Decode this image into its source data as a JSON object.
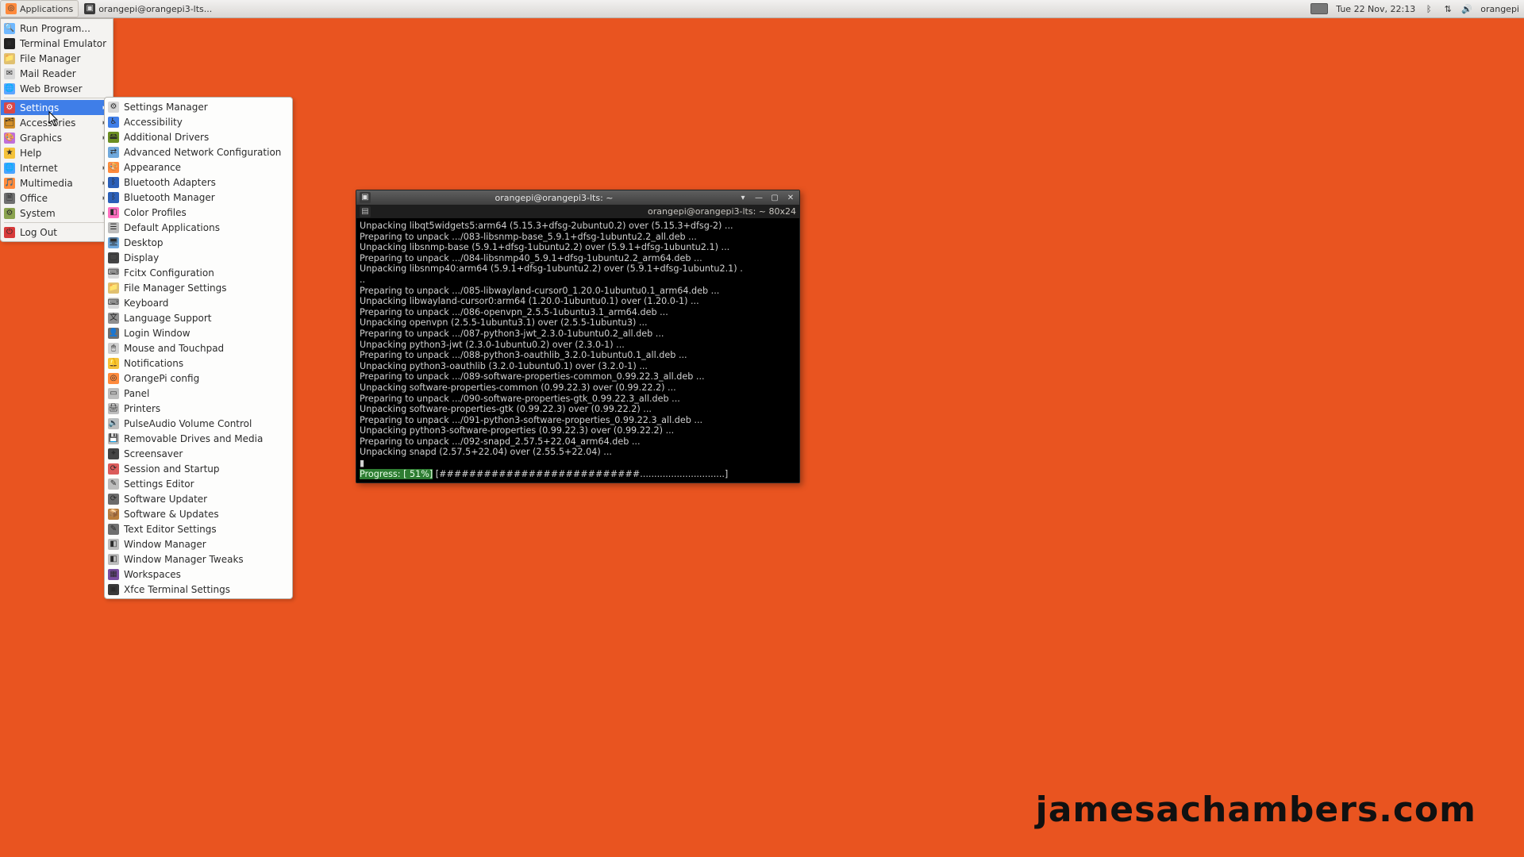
{
  "panel": {
    "applications_label": "Applications",
    "task_label": "orangepi@orangepi3-lts...",
    "clock": "Tue 22 Nov, 22:13",
    "user": "orangepi"
  },
  "menu": {
    "items": [
      {
        "label": "Run Program...",
        "icon_bg": "#6fb8ff",
        "glyph": "🔍",
        "arrow": false
      },
      {
        "label": "Terminal Emulator",
        "icon_bg": "#222",
        "glyph": "▣",
        "arrow": false
      },
      {
        "label": "File Manager",
        "icon_bg": "#e0c070",
        "glyph": "📁",
        "arrow": false
      },
      {
        "label": "Mail Reader",
        "icon_bg": "#d8d8d8",
        "glyph": "✉",
        "arrow": false
      },
      {
        "label": "Web Browser",
        "icon_bg": "#5da5ff",
        "glyph": "🌐",
        "arrow": false
      },
      {
        "label": "Settings",
        "icon_bg": "#d94747",
        "glyph": "⚙",
        "arrow": true,
        "highlight": true
      },
      {
        "label": "Accessories",
        "icon_bg": "#d28f2a",
        "glyph": "🗂",
        "arrow": true
      },
      {
        "label": "Graphics",
        "icon_bg": "#c06fd8",
        "glyph": "🎨",
        "arrow": true
      },
      {
        "label": "Help",
        "icon_bg": "#f4c23a",
        "glyph": "★",
        "arrow": false
      },
      {
        "label": "Internet",
        "icon_bg": "#4aa3ff",
        "glyph": "🌐",
        "arrow": true
      },
      {
        "label": "Multimedia",
        "icon_bg": "#ff8a3c",
        "glyph": "🎵",
        "arrow": true
      },
      {
        "label": "Office",
        "icon_bg": "#6f6f6f",
        "glyph": "🗎",
        "arrow": true
      },
      {
        "label": "System",
        "icon_bg": "#8aa34e",
        "glyph": "⚙",
        "arrow": true
      },
      {
        "label": "Log Out",
        "icon_bg": "#d73a3a",
        "glyph": "⏻",
        "arrow": false
      }
    ],
    "separator_after_index": 4,
    "separator_after_index2": 12
  },
  "submenu": {
    "items": [
      {
        "label": "Settings Manager",
        "icon_bg": "#d8d8d8",
        "glyph": "⚙"
      },
      {
        "label": "Accessibility",
        "icon_bg": "#3f7ee8",
        "glyph": "♿"
      },
      {
        "label": "Additional Drivers",
        "icon_bg": "#6b8e23",
        "glyph": "🖴"
      },
      {
        "label": "Advanced Network Configuration",
        "icon_bg": "#6fa8dc",
        "glyph": "⇄"
      },
      {
        "label": "Appearance",
        "icon_bg": "#ff8a3c",
        "glyph": "🎨"
      },
      {
        "label": "Bluetooth Adapters",
        "icon_bg": "#2b5fb8",
        "glyph": "ᛒ"
      },
      {
        "label": "Bluetooth Manager",
        "icon_bg": "#2b5fb8",
        "glyph": "ᛒ"
      },
      {
        "label": "Color Profiles",
        "icon_bg": "#ff6fbf",
        "glyph": "◧"
      },
      {
        "label": "Default Applications",
        "icon_bg": "#bdbdbd",
        "glyph": "☰"
      },
      {
        "label": "Desktop",
        "icon_bg": "#6fa8dc",
        "glyph": "🖥"
      },
      {
        "label": "Display",
        "icon_bg": "#444",
        "glyph": "🖵"
      },
      {
        "label": "Fcitx Configuration",
        "icon_bg": "#d8d8d8",
        "glyph": "⌨"
      },
      {
        "label": "File Manager Settings",
        "icon_bg": "#e0c070",
        "glyph": "📁"
      },
      {
        "label": "Keyboard",
        "icon_bg": "#d8d8d8",
        "glyph": "⌨"
      },
      {
        "label": "Language Support",
        "icon_bg": "#8f8f8f",
        "glyph": "文"
      },
      {
        "label": "Login Window",
        "icon_bg": "#6f6f6f",
        "glyph": "👤"
      },
      {
        "label": "Mouse and Touchpad",
        "icon_bg": "#cfcfcf",
        "glyph": "🖱"
      },
      {
        "label": "Notifications",
        "icon_bg": "#f4c23a",
        "glyph": "🔔"
      },
      {
        "label": "OrangePi config",
        "icon_bg": "#ff8a3c",
        "glyph": "◎"
      },
      {
        "label": "Panel",
        "icon_bg": "#bdbdbd",
        "glyph": "▭"
      },
      {
        "label": "Printers",
        "icon_bg": "#bdbdbd",
        "glyph": "🖨"
      },
      {
        "label": "PulseAudio Volume Control",
        "icon_bg": "#bdbdbd",
        "glyph": "🔊"
      },
      {
        "label": "Removable Drives and Media",
        "icon_bg": "#bdbdbd",
        "glyph": "💾"
      },
      {
        "label": "Screensaver",
        "icon_bg": "#444",
        "glyph": "✦"
      },
      {
        "label": "Session and Startup",
        "icon_bg": "#db5b5b",
        "glyph": "⟳"
      },
      {
        "label": "Settings Editor",
        "icon_bg": "#bdbdbd",
        "glyph": "✎"
      },
      {
        "label": "Software Updater",
        "icon_bg": "#6b6b6b",
        "glyph": "⟳"
      },
      {
        "label": "Software & Updates",
        "icon_bg": "#b87d3c",
        "glyph": "📦"
      },
      {
        "label": "Text Editor Settings",
        "icon_bg": "#6f6f6f",
        "glyph": "✎"
      },
      {
        "label": "Window Manager",
        "icon_bg": "#bdbdbd",
        "glyph": "◧"
      },
      {
        "label": "Window Manager Tweaks",
        "icon_bg": "#bdbdbd",
        "glyph": "◧"
      },
      {
        "label": "Workspaces",
        "icon_bg": "#7a4ea0",
        "glyph": "▦"
      },
      {
        "label": "Xfce Terminal Settings",
        "icon_bg": "#3a3a3a",
        "glyph": "▣"
      }
    ]
  },
  "terminal": {
    "title": "orangepi@orangepi3-lts: ~",
    "dims": "orangepi@orangepi3-lts: ~  80x24",
    "progress_label": "Progress: [ 51%]",
    "progress_bar": "[###########################..............................]",
    "lines": [
      "Unpacking libqt5widgets5:arm64 (5.15.3+dfsg-2ubuntu0.2) over (5.15.3+dfsg-2) ...",
      "Preparing to unpack .../083-libsnmp-base_5.9.1+dfsg-1ubuntu2.2_all.deb ...",
      "Unpacking libsnmp-base (5.9.1+dfsg-1ubuntu2.2) over (5.9.1+dfsg-1ubuntu2.1) ...",
      "Preparing to unpack .../084-libsnmp40_5.9.1+dfsg-1ubuntu2.2_arm64.deb ...",
      "Unpacking libsnmp40:arm64 (5.9.1+dfsg-1ubuntu2.2) over (5.9.1+dfsg-1ubuntu2.1) .",
      "..",
      "Preparing to unpack .../085-libwayland-cursor0_1.20.0-1ubuntu0.1_arm64.deb ...",
      "Unpacking libwayland-cursor0:arm64 (1.20.0-1ubuntu0.1) over (1.20.0-1) ...",
      "Preparing to unpack .../086-openvpn_2.5.5-1ubuntu3.1_arm64.deb ...",
      "Unpacking openvpn (2.5.5-1ubuntu3.1) over (2.5.5-1ubuntu3) ...",
      "Preparing to unpack .../087-python3-jwt_2.3.0-1ubuntu0.2_all.deb ...",
      "Unpacking python3-jwt (2.3.0-1ubuntu0.2) over (2.3.0-1) ...",
      "Preparing to unpack .../088-python3-oauthlib_3.2.0-1ubuntu0.1_all.deb ...",
      "Unpacking python3-oauthlib (3.2.0-1ubuntu0.1) over (3.2.0-1) ...",
      "Preparing to unpack .../089-software-properties-common_0.99.22.3_all.deb ...",
      "Unpacking software-properties-common (0.99.22.3) over (0.99.22.2) ...",
      "Preparing to unpack .../090-software-properties-gtk_0.99.22.3_all.deb ...",
      "Unpacking software-properties-gtk (0.99.22.3) over (0.99.22.2) ...",
      "Preparing to unpack .../091-python3-software-properties_0.99.22.3_all.deb ...",
      "Unpacking python3-software-properties (0.99.22.3) over (0.99.22.2) ...",
      "Preparing to unpack .../092-snapd_2.57.5+22.04_arm64.deb ...",
      "Unpacking snapd (2.57.5+22.04) over (2.55.5+22.04) ...",
      "▮"
    ]
  },
  "watermark": "jamesachambers.com"
}
